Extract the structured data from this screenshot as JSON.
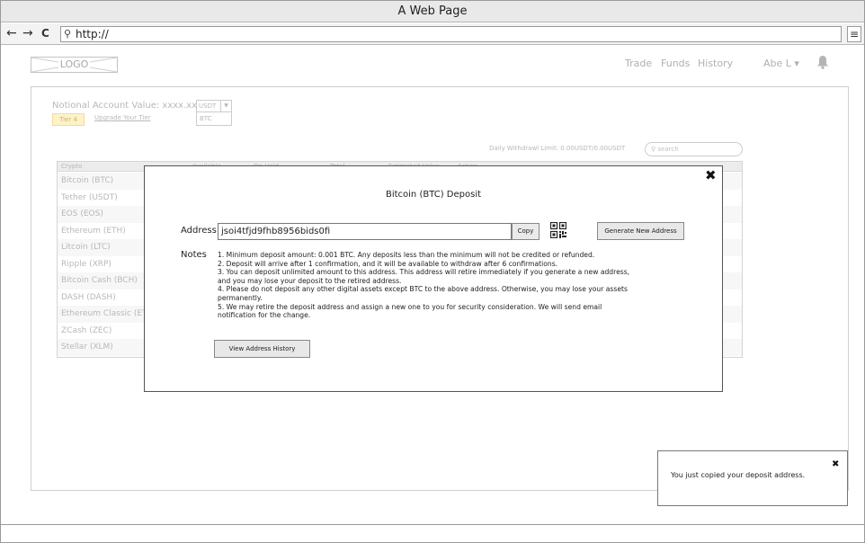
{
  "browser": {
    "title": "A Web Page",
    "url": "http://",
    "back_glyph": "←",
    "forward_glyph": "→",
    "reload_glyph": "C",
    "menu_glyph": "≡"
  },
  "header": {
    "logo": "LOGO",
    "nav": [
      "Trade",
      "Funds",
      "History"
    ],
    "user": "Abe L ▾",
    "bell_icon": "bell-icon"
  },
  "account": {
    "notional": "Notional Account Value: xxxx.xx",
    "tier": "Tier 4",
    "upgrade": "Upgrade Your Tier",
    "currency_selected": "USDT",
    "currency_option": "BTC"
  },
  "withdraw_limit": "Daily Withdrawl Limit: 0.00USDT/0.00USDT",
  "search": {
    "placeholder": "search"
  },
  "table": {
    "headers": [
      "Crypto",
      "Available",
      "On Hold",
      "Total",
      "Estimated Value",
      "Action"
    ],
    "rows": [
      "Bitcoin (BTC)",
      "Tether (USDT)",
      "EOS (EOS)",
      "Ethereum (ETH)",
      "Litcoin (LTC)",
      "Ripple (XRP)",
      "Bitcoin Cash (BCH)",
      "DASH (DASH)",
      "Ethereum Classic (ETC)",
      "ZCash (ZEC)",
      "Stellar (XLM)"
    ]
  },
  "modal": {
    "title": "Bitcoin (BTC) Deposit",
    "address_label": "Address",
    "address_value": "jsoi4tfjd9fhb8956bids0fi",
    "copy": "Copy",
    "generate": "Generate New Address",
    "notes_label": "Notes",
    "notes": [
      "1. Minimum deposit amount: 0.001 BTC. Any deposits less than the minimum will not be credited or refunded.",
      "2. Deposit will arrive after 1 confirmation, and it will be available to withdraw after 6 confirmations.",
      "3. You can deposit unlimited amount to this address. This address will retire immediately if you generate a new address,",
      "and you may lose your deposit to the retired address.",
      "4. Please do not deposit any other digital assets except BTC to the above address. Otherwise, you may lose your assets",
      "permanently.",
      "5.  We may retire the deposit address and assign a new one to you for security consideration. We will send email",
      "notification for the change."
    ],
    "history_button": "View Address History",
    "close_glyph": "✖"
  },
  "toast": {
    "message": "You just copied your deposit address.",
    "close_glyph": "✖"
  }
}
